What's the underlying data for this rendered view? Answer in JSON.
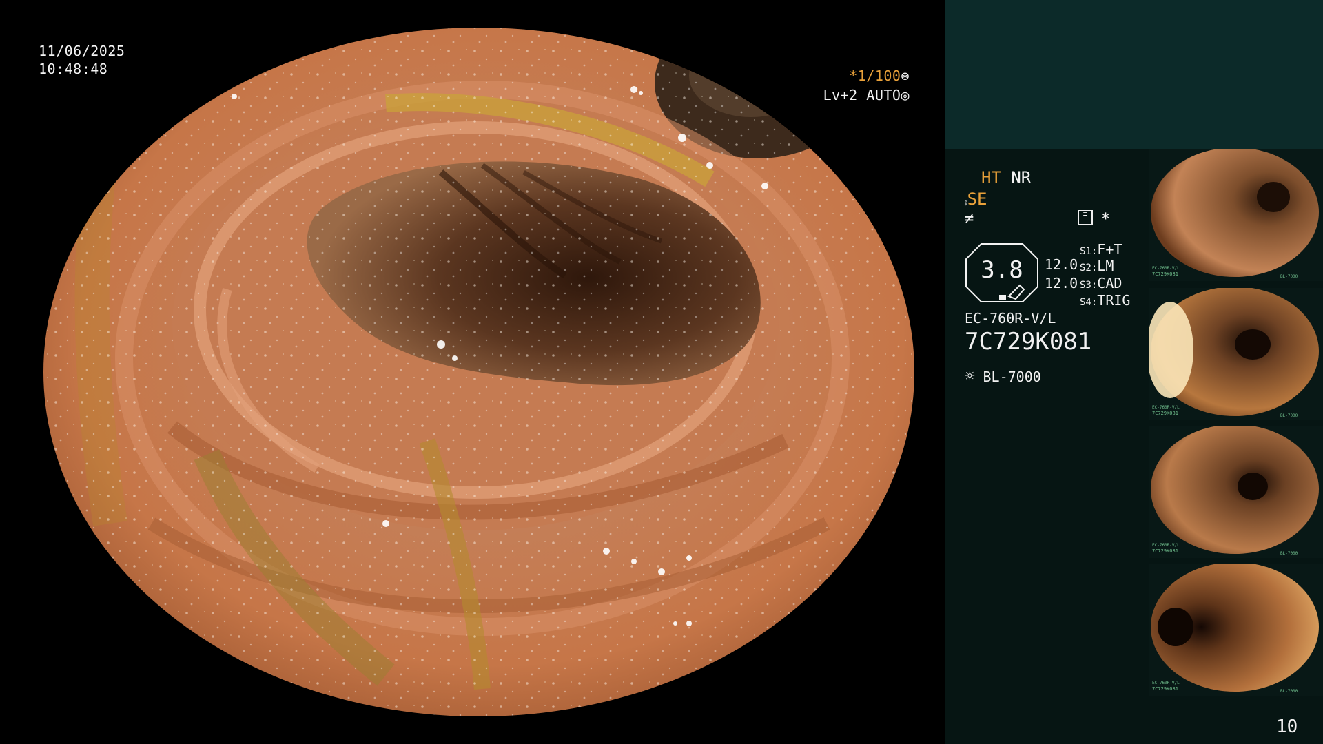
{
  "osd": {
    "date": "11/06/2025",
    "time": "10:48:48",
    "shutter": "*1/100",
    "shutter_icon": "shutter-icon",
    "level": "Lv+2",
    "auto": "AUTO",
    "auto_icon": "iris-icon"
  },
  "panel": {
    "ht": "HT",
    "nr": "NR",
    "se": "SE",
    "settings_icon": "menu-icon",
    "asterisk": "*",
    "level_value": "3.8",
    "val_1": "12.0",
    "val_2": "12.0",
    "s1_label": "S1:",
    "s1_value": "F+T",
    "s2_label": "S2:",
    "s2_value": "LM",
    "s3_label": "S3:",
    "s3_value": "CAD",
    "s4_label": "S4:",
    "s4_value": "TRIG",
    "scope_model": "EC-760R-V/L",
    "serial": "7C729K081",
    "light_source": "BL-7000",
    "page_number": "10"
  },
  "thumbnails": [
    {
      "label_model": "EC-760R-V/L",
      "label_serial": "7C729K081",
      "light": "BL-7000"
    },
    {
      "label_model": "EC-760R-V/L",
      "label_serial": "7C729K081",
      "light": "BL-7000"
    },
    {
      "label_model": "EC-760R-V/L",
      "label_serial": "7C729K081",
      "light": "BL-7000"
    },
    {
      "label_model": "EC-760R-V/L",
      "label_serial": "7C729K081",
      "light": "BL-7000"
    }
  ],
  "colors": {
    "background": "#000000",
    "panel": "#061513",
    "panel_top": "#0c2a29",
    "accent": "#e9a13a",
    "mucosa": "#c0764a",
    "lumen": "#4a2a18"
  }
}
